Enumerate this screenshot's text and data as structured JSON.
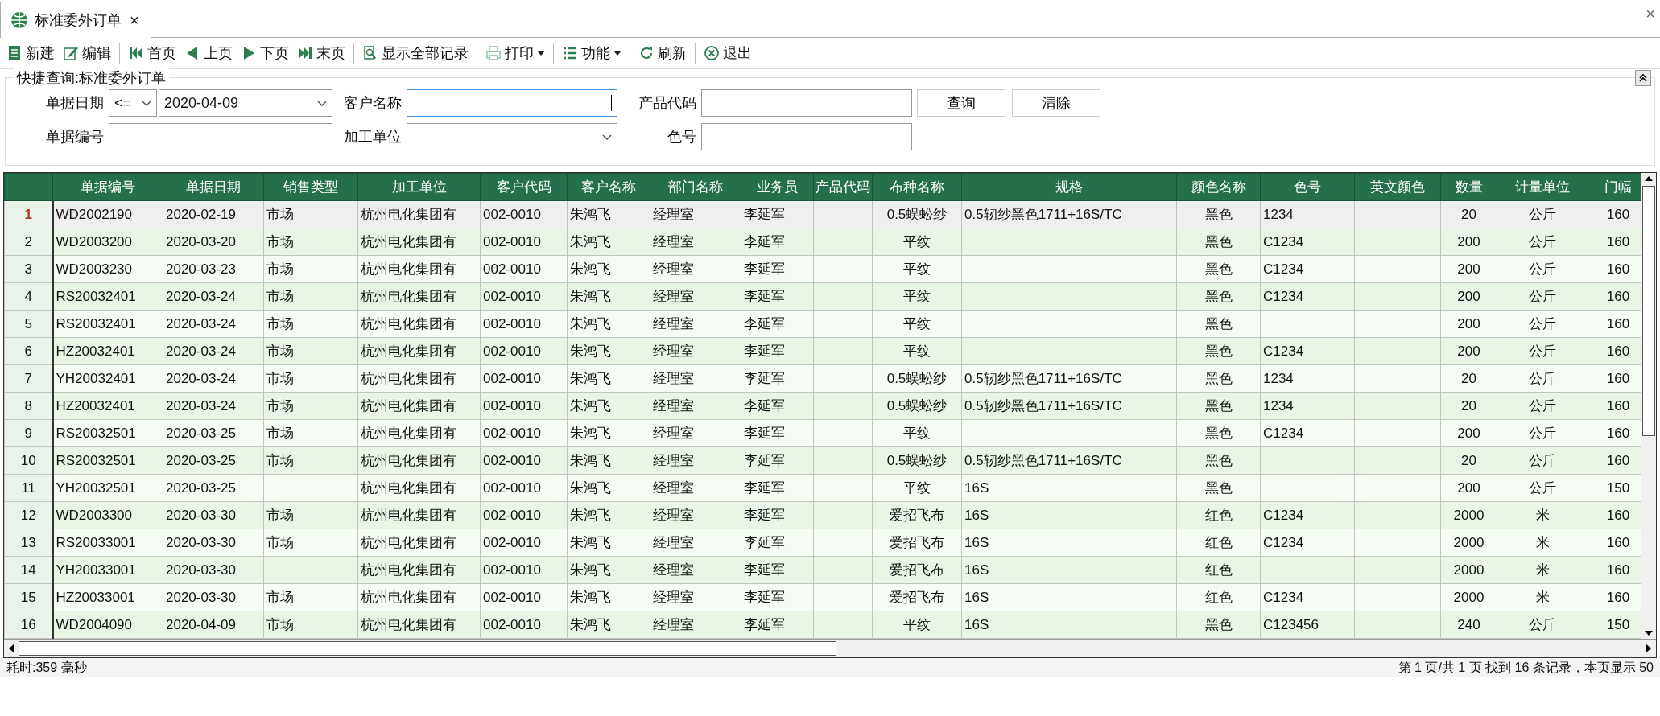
{
  "tabs": [
    {
      "label": "标准委外订单",
      "selected": true,
      "close": "×"
    }
  ],
  "window_close": "×",
  "toolbar": [
    [
      {
        "label": "新建",
        "kind": "button"
      },
      {
        "label": "编辑",
        "kind": "button"
      }
    ],
    [
      {
        "label": "首页",
        "kind": "button"
      },
      {
        "label": "上页",
        "kind": "button"
      },
      {
        "label": "下页",
        "kind": "button"
      },
      {
        "label": "末页",
        "kind": "button"
      }
    ],
    [
      {
        "label": "显示全部记录",
        "kind": "button"
      }
    ],
    [
      {
        "label": "打印",
        "kind": "dropdown"
      }
    ],
    [
      {
        "label": "功能",
        "kind": "dropdown"
      }
    ],
    [
      {
        "label": "刷新",
        "kind": "button"
      }
    ],
    [
      {
        "label": "退出",
        "kind": "button"
      }
    ]
  ],
  "query": {
    "title": "快捷查询:标准委外订单",
    "rows": [
      [
        {
          "label": "单据日期",
          "kind": "range",
          "operator": "<=",
          "value": "2020-04-09"
        },
        {
          "label": "客户名称",
          "kind": "input",
          "focused": true
        },
        {
          "label": "产品代码",
          "kind": "input",
          "focused": false
        }
      ],
      [
        {
          "label": "单据编号",
          "kind": "input",
          "focused": false
        },
        {
          "label": "加工单位",
          "kind": "select"
        },
        {
          "label": "色号",
          "kind": "input",
          "focused": false
        }
      ]
    ],
    "buttons": [
      "查询",
      "清除"
    ]
  },
  "table": {
    "columns": [
      "",
      "单据编号",
      "单据日期",
      "销售类型",
      "加工单位",
      "客户代码",
      "客户名称",
      "部门名称",
      "业务员",
      "产品代码",
      "布种名称",
      "规格",
      "颜色名称",
      "色号",
      "英文颜色",
      "数量",
      "计量单位",
      "门幅"
    ],
    "rows": [
      {
        "selected": true,
        "cells": [
          "1",
          "WD2002190",
          "2020-02-19",
          "市场",
          "杭州电化集团有",
          "002-0010",
          "朱鸿飞",
          "经理室",
          "李延军",
          "",
          "0.5蜈蚣纱",
          "0.5轫纱黑色1711+16S/TC",
          "黑色",
          "1234",
          "",
          "20",
          "公斤",
          "160"
        ]
      },
      {
        "selected": false,
        "cells": [
          "2",
          "WD2003200",
          "2020-03-20",
          "市场",
          "杭州电化集团有",
          "002-0010",
          "朱鸿飞",
          "经理室",
          "李延军",
          "",
          "平纹",
          "",
          "黑色",
          "C1234",
          "",
          "200",
          "公斤",
          "160"
        ]
      },
      {
        "selected": false,
        "cells": [
          "3",
          "WD2003230",
          "2020-03-23",
          "市场",
          "杭州电化集团有",
          "002-0010",
          "朱鸿飞",
          "经理室",
          "李延军",
          "",
          "平纹",
          "",
          "黑色",
          "C1234",
          "",
          "200",
          "公斤",
          "160"
        ]
      },
      {
        "selected": false,
        "cells": [
          "4",
          "RS20032401",
          "2020-03-24",
          "市场",
          "杭州电化集团有",
          "002-0010",
          "朱鸿飞",
          "经理室",
          "李延军",
          "",
          "平纹",
          "",
          "黑色",
          "C1234",
          "",
          "200",
          "公斤",
          "160"
        ]
      },
      {
        "selected": false,
        "cells": [
          "5",
          "RS20032401",
          "2020-03-24",
          "市场",
          "杭州电化集团有",
          "002-0010",
          "朱鸿飞",
          "经理室",
          "李延军",
          "",
          "平纹",
          "",
          "黑色",
          "",
          "",
          "200",
          "公斤",
          "160"
        ]
      },
      {
        "selected": false,
        "cells": [
          "6",
          "HZ20032401",
          "2020-03-24",
          "市场",
          "杭州电化集团有",
          "002-0010",
          "朱鸿飞",
          "经理室",
          "李延军",
          "",
          "平纹",
          "",
          "黑色",
          "C1234",
          "",
          "200",
          "公斤",
          "160"
        ]
      },
      {
        "selected": false,
        "cells": [
          "7",
          "YH20032401",
          "2020-03-24",
          "市场",
          "杭州电化集团有",
          "002-0010",
          "朱鸿飞",
          "经理室",
          "李延军",
          "",
          "0.5蜈蚣纱",
          "0.5轫纱黑色1711+16S/TC",
          "黑色",
          "1234",
          "",
          "20",
          "公斤",
          "160"
        ]
      },
      {
        "selected": false,
        "cells": [
          "8",
          "HZ20032401",
          "2020-03-24",
          "市场",
          "杭州电化集团有",
          "002-0010",
          "朱鸿飞",
          "经理室",
          "李延军",
          "",
          "0.5蜈蚣纱",
          "0.5轫纱黑色1711+16S/TC",
          "黑色",
          "1234",
          "",
          "20",
          "公斤",
          "160"
        ]
      },
      {
        "selected": false,
        "cells": [
          "9",
          "RS20032501",
          "2020-03-25",
          "市场",
          "杭州电化集团有",
          "002-0010",
          "朱鸿飞",
          "经理室",
          "李延军",
          "",
          "平纹",
          "",
          "黑色",
          "C1234",
          "",
          "200",
          "公斤",
          "160"
        ]
      },
      {
        "selected": false,
        "cells": [
          "10",
          "RS20032501",
          "2020-03-25",
          "市场",
          "杭州电化集团有",
          "002-0010",
          "朱鸿飞",
          "经理室",
          "李延军",
          "",
          "0.5蜈蚣纱",
          "0.5轫纱黑色1711+16S/TC",
          "黑色",
          "",
          "",
          "20",
          "公斤",
          "160"
        ]
      },
      {
        "selected": false,
        "cells": [
          "11",
          "YH20032501",
          "2020-03-25",
          "",
          "杭州电化集团有",
          "002-0010",
          "朱鸿飞",
          "经理室",
          "李延军",
          "",
          "平纹",
          "16S",
          "黑色",
          "",
          "",
          "200",
          "公斤",
          "150"
        ]
      },
      {
        "selected": false,
        "cells": [
          "12",
          "WD2003300",
          "2020-03-30",
          "市场",
          "杭州电化集团有",
          "002-0010",
          "朱鸿飞",
          "经理室",
          "李延军",
          "",
          "爱招飞布",
          "16S",
          "红色",
          "C1234",
          "",
          "2000",
          "米",
          "160"
        ]
      },
      {
        "selected": false,
        "cells": [
          "13",
          "RS20033001",
          "2020-03-30",
          "市场",
          "杭州电化集团有",
          "002-0010",
          "朱鸿飞",
          "经理室",
          "李延军",
          "",
          "爱招飞布",
          "16S",
          "红色",
          "C1234",
          "",
          "2000",
          "米",
          "160"
        ]
      },
      {
        "selected": false,
        "cells": [
          "14",
          "YH20033001",
          "2020-03-30",
          "",
          "杭州电化集团有",
          "002-0010",
          "朱鸿飞",
          "经理室",
          "李延军",
          "",
          "爱招飞布",
          "16S",
          "红色",
          "",
          "",
          "2000",
          "米",
          "160"
        ]
      },
      {
        "selected": false,
        "cells": [
          "15",
          "HZ20033001",
          "2020-03-30",
          "市场",
          "杭州电化集团有",
          "002-0010",
          "朱鸿飞",
          "经理室",
          "李延军",
          "",
          "爱招飞布",
          "16S",
          "红色",
          "C1234",
          "",
          "2000",
          "米",
          "160"
        ]
      },
      {
        "selected": false,
        "cells": [
          "16",
          "WD2004090",
          "2020-04-09",
          "市场",
          "杭州电化集团有",
          "002-0010",
          "朱鸿飞",
          "经理室",
          "李延军",
          "",
          "平纹",
          "16S",
          "黑色",
          "C123456",
          "",
          "240",
          "公斤",
          "150"
        ]
      }
    ]
  },
  "status_bar": {
    "left": "耗时:359 毫秒",
    "right": "第 1 页/共 1 页 找到 16 条记录，本页显示 50"
  }
}
